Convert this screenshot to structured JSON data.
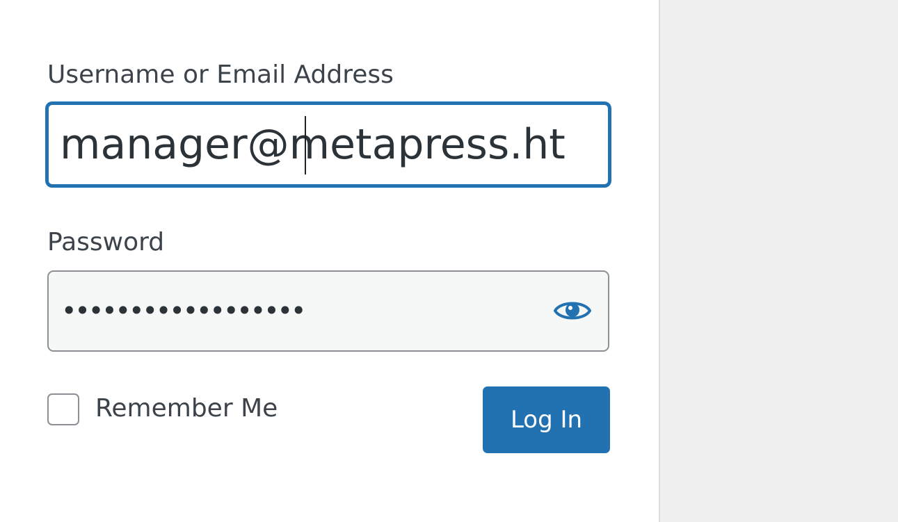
{
  "login_form": {
    "username_label": "Username or Email Address",
    "username_value": "manager@metapress.ht",
    "password_label": "Password",
    "password_masked": "••••••••••••••••••",
    "show_password_icon": "eye-icon",
    "remember_label": "Remember Me",
    "remember_checked": false,
    "login_button_label": "Log In"
  },
  "colors": {
    "accent": "#2271b1",
    "text": "#3c434a",
    "background": "#f0f0f1",
    "panel": "#ffffff"
  }
}
